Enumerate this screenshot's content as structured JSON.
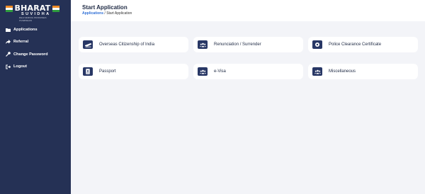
{
  "logo": {
    "word": "BHARAT",
    "sub": "SUVIDHA",
    "tagline": "DELIVERING PROMISES OVERSEAS"
  },
  "sidebar": {
    "items": [
      {
        "label": "Applications",
        "icon": "folder-icon"
      },
      {
        "label": "Referral",
        "icon": "share-icon"
      },
      {
        "label": "Change Password",
        "icon": "key-icon"
      },
      {
        "label": "Logout",
        "icon": "logout-icon"
      }
    ]
  },
  "header": {
    "title": "Start Application",
    "breadcrumb": {
      "link": "Applications",
      "separator": "/",
      "current": "Start Application"
    }
  },
  "cards": [
    {
      "label": "Overseas Citizenship of India",
      "icon": "plane-icon"
    },
    {
      "label": "Renunciation / Surrender",
      "icon": "group-icon"
    },
    {
      "label": "Police Clearance Certificate",
      "icon": "record-icon"
    },
    {
      "label": "Passport",
      "icon": "passport-icon"
    },
    {
      "label": "e-Visa",
      "icon": "group-icon"
    },
    {
      "label": "Miscellaneous",
      "icon": "group-icon"
    }
  ],
  "colors": {
    "sidebar": "#253155",
    "accent": "#2f6fd6",
    "icon_bg": "#283765",
    "page_bg": "#f3f4f8"
  }
}
